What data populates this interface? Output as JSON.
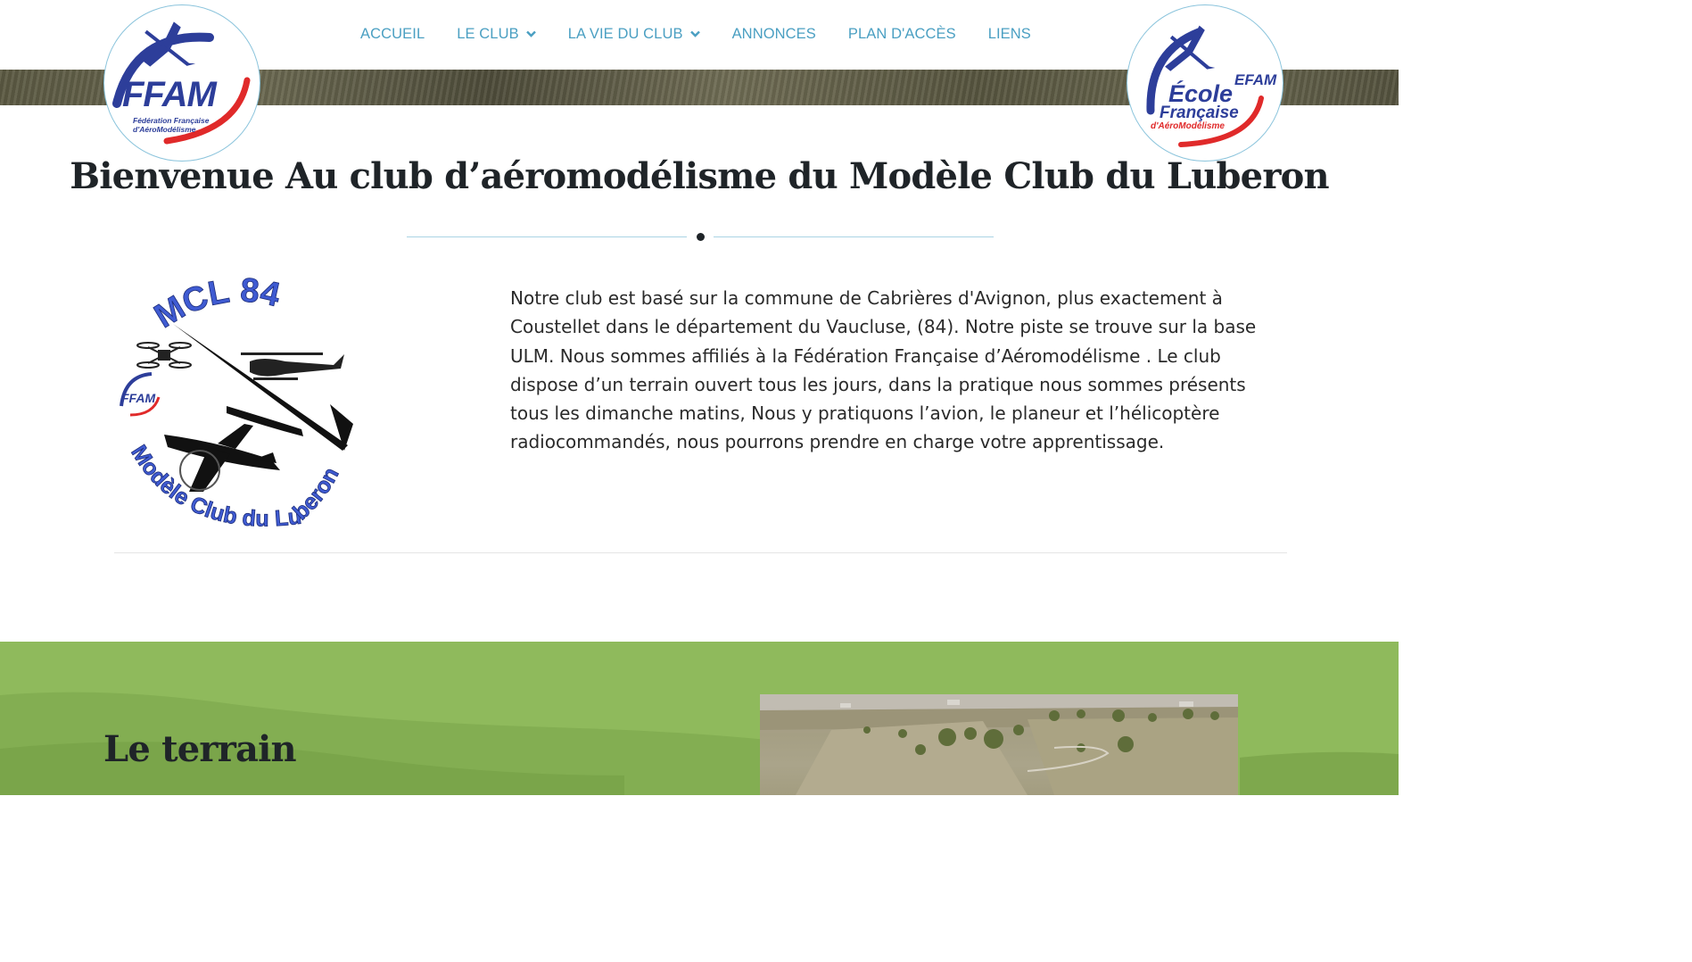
{
  "nav": {
    "items": [
      {
        "label": "ACCUEIL",
        "has_dropdown": false
      },
      {
        "label": "LE CLUB",
        "has_dropdown": true
      },
      {
        "label": "LA VIE DU CLUB",
        "has_dropdown": true
      },
      {
        "label": "ANNONCES",
        "has_dropdown": false
      },
      {
        "label": "PLAN D'ACCÈS",
        "has_dropdown": false
      },
      {
        "label": "LIENS",
        "has_dropdown": false
      }
    ],
    "color": "#4a9fc2"
  },
  "logos": {
    "ffam": {
      "title": "FFAM",
      "subtitle": "Fédération Française d'AéroModélisme"
    },
    "efam": {
      "badge": "EFAM",
      "line1": "École",
      "line2": "Française",
      "subtitle": "d'AéroModélisme"
    },
    "club": {
      "ring_top": "MCL 84",
      "ring_bottom": "Modèle Club du Luberon",
      "mini": "FFAM"
    }
  },
  "welcome": {
    "title": "Bienvenue Au club d’aéromodélisme du Modèle Club du Luberon",
    "text": "Notre club est basé sur la commune de Cabrières d'Avignon, plus exactement à Coustellet dans le département du Vaucluse, (84). Notre piste se trouve sur la base ULM. Nous sommes affiliés à la Fédération Française d’Aéromodélisme . Le club dispose d’un terrain ouvert tous les jours, dans la pratique nous sommes présents tous les dimanche matins, Nous y pratiquons l’avion, le planeur et l’hélicoptère radiocommandés, nous pourrons prendre en charge votre apprentissage."
  },
  "terrain": {
    "title": "Le terrain"
  },
  "colors": {
    "heading": "#1f2428",
    "accent_line": "#a9d3e4",
    "green_section": "#8fba5c",
    "logo_blue": "#2d3e9a",
    "logo_red": "#e02a2a"
  }
}
